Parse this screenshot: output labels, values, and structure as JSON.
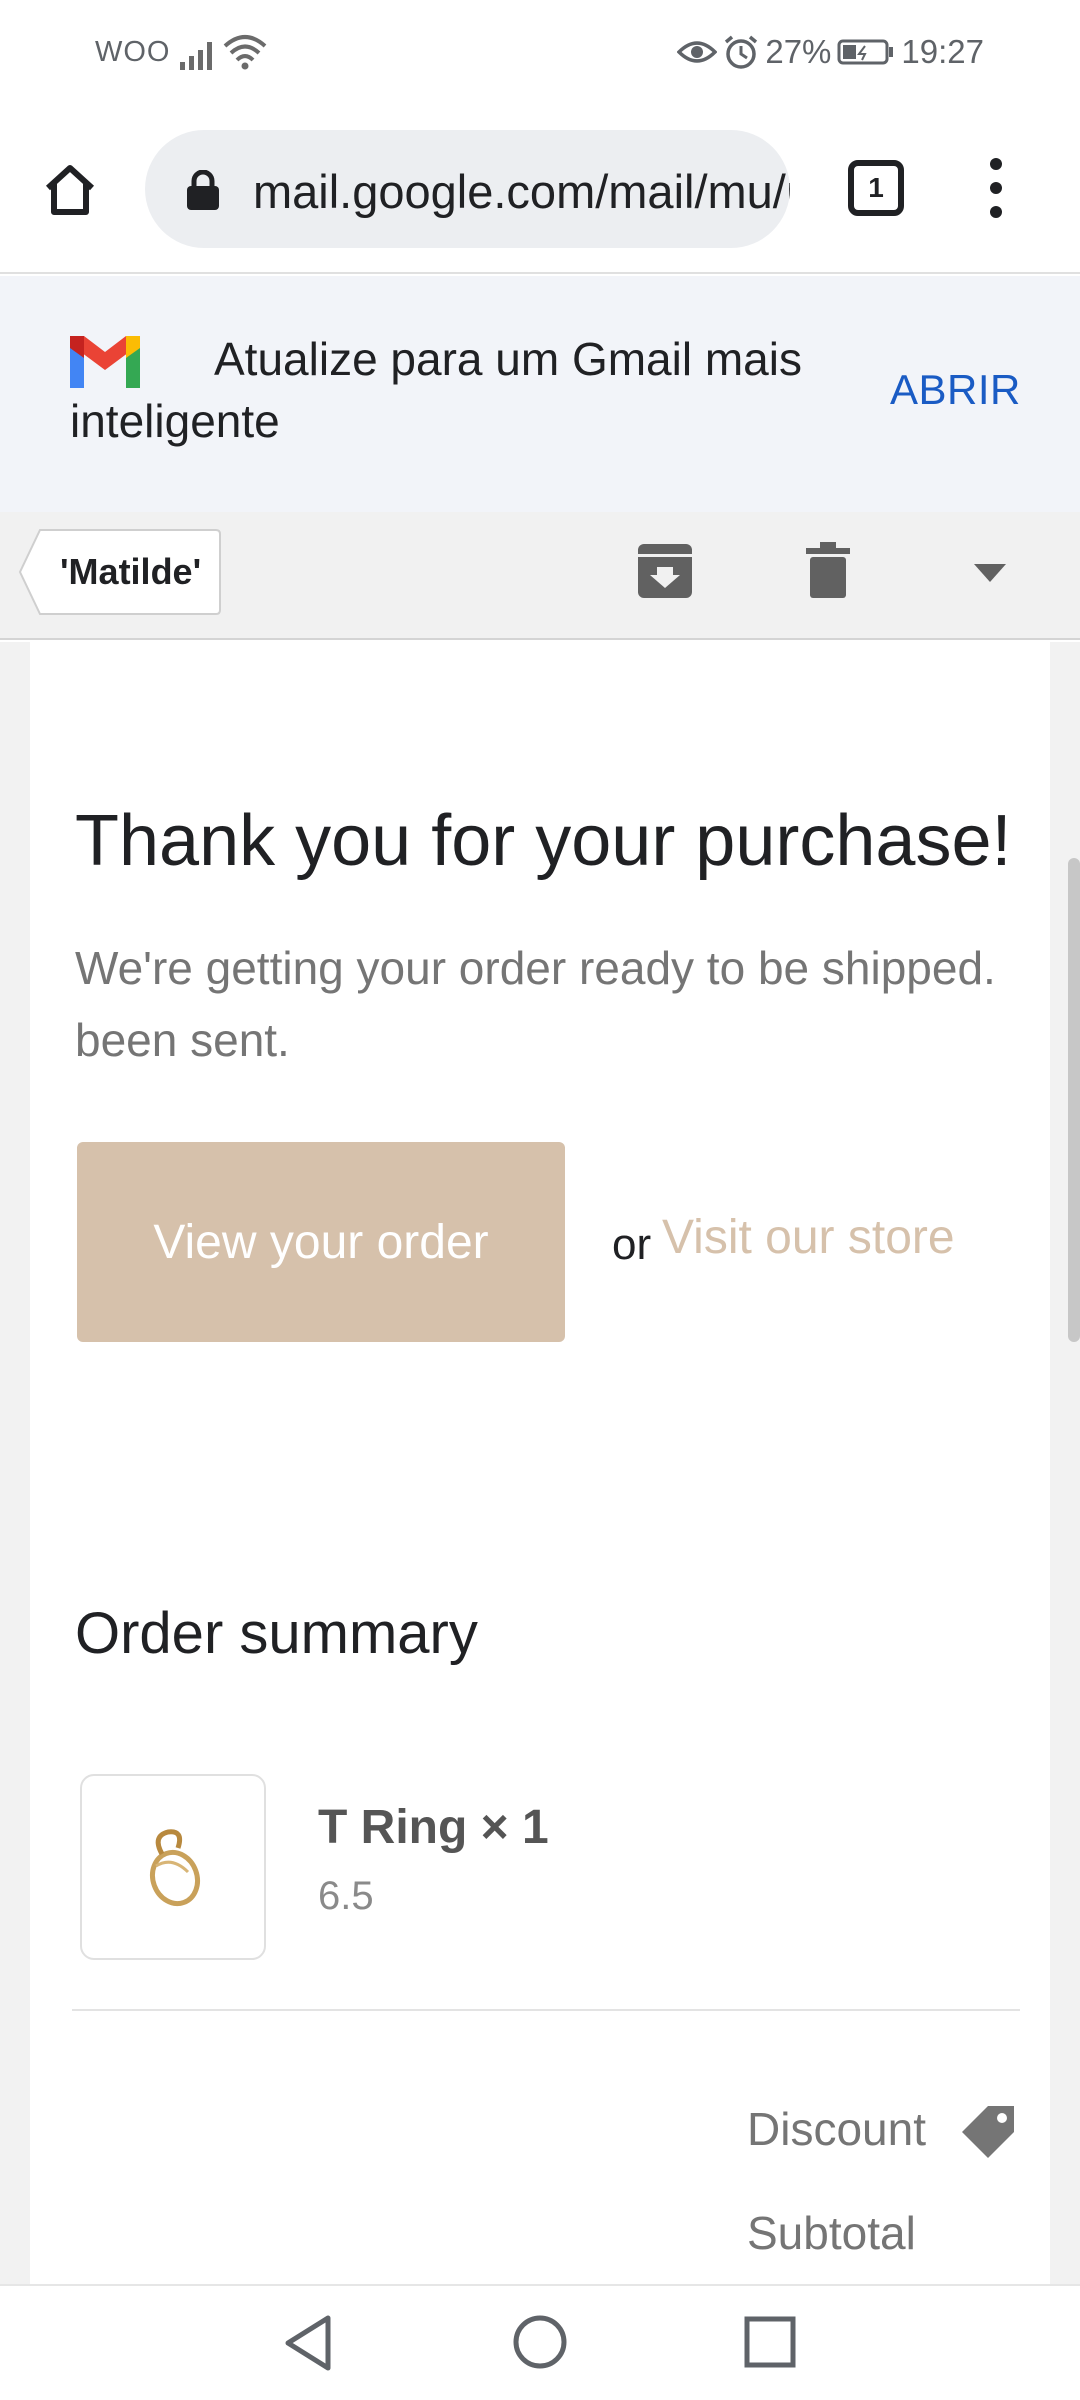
{
  "status_bar": {
    "carrier": "WOO",
    "battery_percent": "27%",
    "time": "19:27",
    "icons": [
      "signal-icon",
      "wifi-icon",
      "eye-icon",
      "alarm-icon",
      "battery-icon"
    ]
  },
  "browser": {
    "url": "mail.google.com/mail/mu/mp",
    "tab_count": "1",
    "icons": [
      "home-icon",
      "lock-icon",
      "tabs-icon",
      "more-vert-icon"
    ]
  },
  "gmail_banner": {
    "text": "Atualize para um Gmail mais inteligente",
    "action": "ABRIR"
  },
  "email_toolbar": {
    "back_label": "'Matilde'",
    "icons": [
      "archive-icon",
      "trash-icon",
      "dropdown-arrow-icon"
    ]
  },
  "email": {
    "heading": "Thank you for your purchase!",
    "subtext_line1": "We're getting your order ready to be shipped.",
    "subtext_line2": "been sent.",
    "view_order_button": "View your order",
    "or_text": "or",
    "store_link": "Visit our store",
    "summary_title": "Order summary",
    "item": {
      "name": "T Ring × 1",
      "variant": "6.5"
    },
    "discount_label": "Discount",
    "subtotal_label": "Subtotal"
  },
  "colors": {
    "accent": "#d6c1ab",
    "link_blue": "#1a5bc4",
    "banner_bg": "#f2f4f9"
  },
  "nav_bar": {
    "icons": [
      "back-triangle-icon",
      "home-circle-icon",
      "recents-square-icon"
    ]
  }
}
